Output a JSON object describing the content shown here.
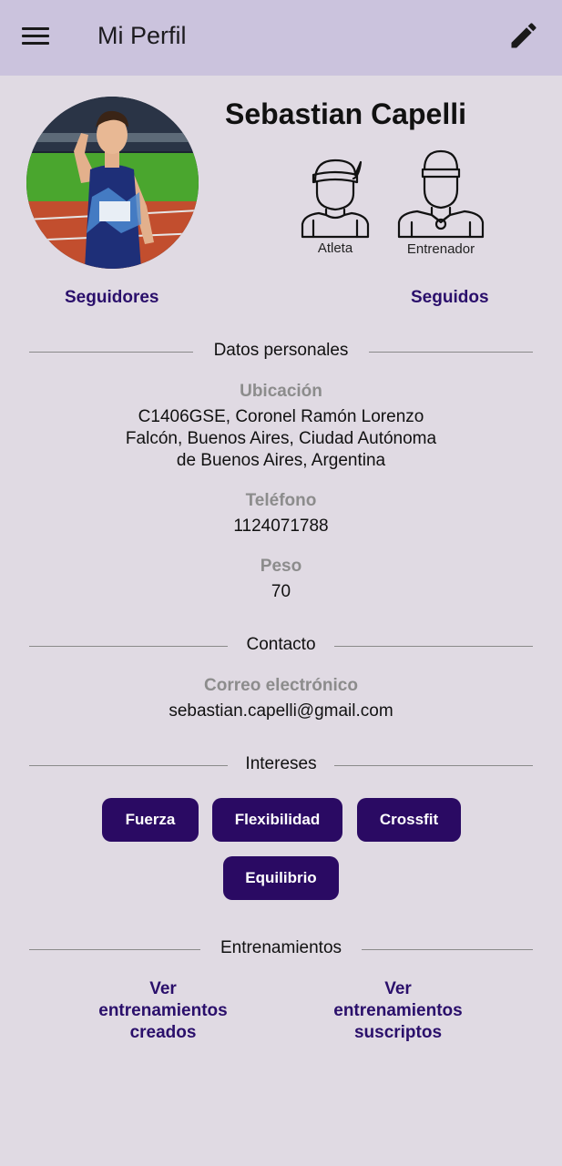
{
  "app_bar": {
    "title": "Mi Perfil"
  },
  "profile": {
    "name": "Sebastian Capelli",
    "roles": [
      "Atleta",
      "Entrenador"
    ],
    "followers_label": "Seguidores",
    "following_label": "Seguidos"
  },
  "sections": {
    "personal": "Datos personales",
    "contact": "Contacto",
    "interests": "Intereses",
    "trainings": "Entrenamientos"
  },
  "personal": {
    "location_label": "Ubicación",
    "location_lines": [
      "C1406GSE, Coronel Ramón Lorenzo",
      "Falcón, Buenos Aires, Ciudad Autónoma",
      "de Buenos Aires, Argentina"
    ],
    "phone_label": "Teléfono",
    "phone": "1124071788",
    "weight_label": "Peso",
    "weight": "70"
  },
  "contact": {
    "email_label": "Correo electrónico",
    "email": "sebastian.capelli@gmail.com"
  },
  "interests": [
    "Fuerza",
    "Flexibilidad",
    "Crossfit",
    "Equilibrio"
  ],
  "trainings": {
    "created_lines": [
      "Ver",
      "entrenamientos",
      "creados"
    ],
    "subscribed_lines": [
      "Ver",
      "entrenamientos",
      "suscriptos"
    ]
  },
  "colors": {
    "app_bar": "#cbc3dd",
    "background": "#e0dae3",
    "accent": "#2a0a63",
    "link": "#2a0f6b"
  }
}
